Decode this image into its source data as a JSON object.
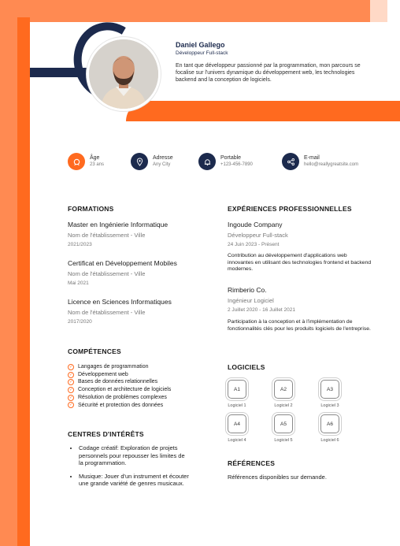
{
  "header": {
    "name": "Daniel Gallego",
    "role": "Développeur Full-stack",
    "intro": "En tant que développeur passionné par la programmation, mon parcours se focalise sur l'univers dynamique du développement web, les technologies backend and la conception de logiciels."
  },
  "info": [
    {
      "label": "Âge",
      "value": "23 ans",
      "icon": "birthday-icon"
    },
    {
      "label": "Adresse",
      "value": "Any City",
      "icon": "location-pin-icon"
    },
    {
      "label": "Portable",
      "value": "+123-456-7890",
      "icon": "phone-icon"
    },
    {
      "label": "E-mail",
      "value": "hello@reallygreatsite.com",
      "icon": "share-icon"
    }
  ],
  "formations": {
    "heading": "FORMATIONS",
    "items": [
      {
        "title": "Master en Ingénierie Informatique",
        "school": "Nom de l'établissement - Ville",
        "date": "2021/2023"
      },
      {
        "title": "Certificat en Développement Mobiles",
        "school": "Nom de l'établissement - Ville",
        "date": "Mai 2021"
      },
      {
        "title": "Licence en Sciences Informatiques",
        "school": "Nom de l'établissement - Ville",
        "date": "2017/2020"
      }
    ]
  },
  "experiences": {
    "heading": "EXPÉRIENCES PROFESSIONNELLES",
    "items": [
      {
        "company": "Ingoude Company",
        "role": "Développeur Full-stack",
        "date": "24 Juin 2023 - Présent",
        "desc": "Contribution au développement d'applications web innovantes en utilisant des technologies frontend et backend modernes."
      },
      {
        "company": "Rimberio Co.",
        "role": "Ingénieur Logiciel",
        "date": "2 Juillet 2020 - 16 Juillet 2021",
        "desc": "Participation à la conception et à l'implémentation de fonctionnalités clés pour les produits logiciels de l'entreprise."
      }
    ]
  },
  "competences": {
    "heading": "COMPÉTENCES",
    "items": [
      "Langages de programmation",
      "Développement web",
      "Bases de données relationnelles",
      "Conception et architecture de logiciels",
      "Résolution de problèmes complexes",
      "Sécurité et protection des données"
    ]
  },
  "interets": {
    "heading": "CENTRES D'INTÉRÊTS",
    "items": [
      "Codage créatif: Exploration de projets personnels pour repousser les limites de la programmation.",
      "Musique: Jouer d'un instrument et écouter une grande variété de genres musicaux."
    ]
  },
  "logiciels": {
    "heading": "LOGICIELS",
    "items": [
      {
        "code": "A1",
        "label": "Logiciel 1"
      },
      {
        "code": "A2",
        "label": "Logiciel 2"
      },
      {
        "code": "A3",
        "label": "Logiciel 3"
      },
      {
        "code": "A4",
        "label": "Logiciel 4"
      },
      {
        "code": "A5",
        "label": "Logiciel 5"
      },
      {
        "code": "A6",
        "label": "Logiciel 6"
      }
    ]
  },
  "references": {
    "heading": "RÉFÉRENCES",
    "text": "Références disponibles sur demande."
  },
  "colors": {
    "accent": "#ff6a1f",
    "accent_light": "#ff8a52",
    "navy": "#1c2a4d"
  }
}
